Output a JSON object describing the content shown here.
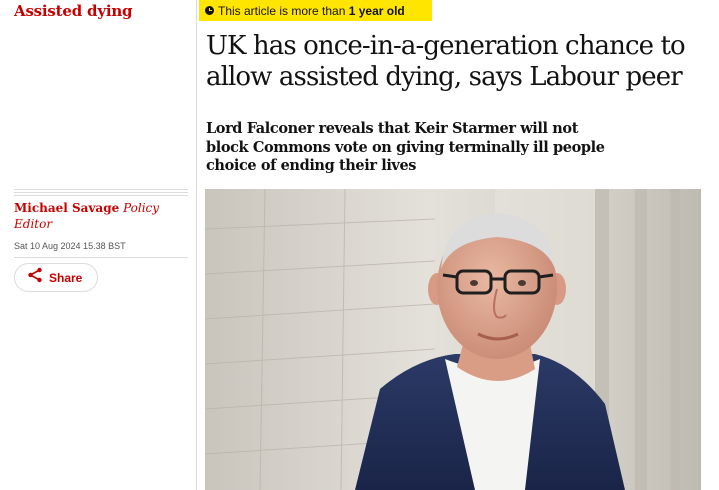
{
  "section": {
    "kicker": "Assisted dying"
  },
  "age_notice": {
    "prefix": "This article is more than ",
    "age": "1 year old"
  },
  "article": {
    "headline": "UK has once-in-a-generation chance to allow assisted dying, says Labour peer",
    "standfirst": "Lord Falconer reveals that Keir Starmer will not block Commons vote on giving terminally ill people choice of ending their lives"
  },
  "byline": {
    "author": "Michael Savage",
    "role": "Policy Editor"
  },
  "dateline": "Sat 10 Aug 2024 15.38 BST",
  "share": {
    "label": "Share",
    "icon": "share-icon"
  },
  "colors": {
    "accent": "#c70000",
    "badge": "#ffe500",
    "text": "#121212"
  }
}
